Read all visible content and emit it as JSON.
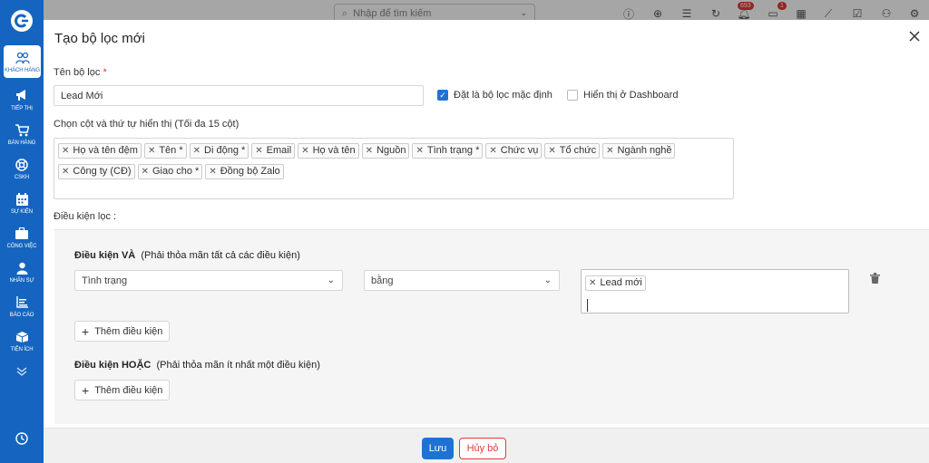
{
  "sidebar": {
    "logo_icon": "brand-logo-icon",
    "items": [
      {
        "label": "KHÁCH HÀNG",
        "icon": "users-icon",
        "active": true
      },
      {
        "label": "TIẾP THỊ",
        "icon": "megaphone-icon"
      },
      {
        "label": "BÁN HÀNG",
        "icon": "cart-icon"
      },
      {
        "label": "CSKH",
        "icon": "lifebuoy-icon"
      },
      {
        "label": "SỰ KIỆN",
        "icon": "calendar-icon"
      },
      {
        "label": "CÔNG VIỆC",
        "icon": "briefcase-icon"
      },
      {
        "label": "NHÂN SỰ",
        "icon": "person-icon"
      },
      {
        "label": "BÁO CÁO",
        "icon": "report-icon"
      },
      {
        "label": "TIỆN ÍCH",
        "icon": "box-icon"
      }
    ]
  },
  "topbar": {
    "search_placeholder": "Nhập để tìm kiếm",
    "notification_count": "693",
    "message_count": "1"
  },
  "modal": {
    "title": "Tạo bộ lọc mới",
    "name_label": "Tên bộ lọc",
    "required_mark": "*",
    "name_value": "Lead Mới",
    "default_filter_label": "Đặt là bộ lọc mặc định",
    "default_filter_checked": true,
    "dashboard_label": "Hiển thị ở Dashboard",
    "dashboard_checked": false,
    "columns_label": "Chọn cột và thứ tự hiển thị (Tối đa 15 cột)",
    "columns": [
      "Họ và tên đệm",
      "Tên *",
      "Di động *",
      "Email",
      "Họ và tên",
      "Nguồn",
      "Tình trạng *",
      "Chức vụ",
      "Tổ chức",
      "Ngành nghề",
      "Công ty (CĐ)",
      "Giao cho *",
      "Đồng bộ Zalo"
    ],
    "conditions_label": "Điều kiện lọc :",
    "and_group": {
      "title": "Điều kiện VÀ",
      "hint": "(Phải thỏa mãn tất cả các điều kiện)",
      "field": "Tình trạng",
      "operator": "bằng",
      "values": [
        "Lead mới"
      ],
      "add_label": "Thêm điều kiện"
    },
    "or_group": {
      "title": "Điều kiện HOẶC",
      "hint": "(Phải thỏa mãn ít nhất một điều kiện)",
      "add_label": "Thêm điều kiện"
    },
    "save_label": "Lưu",
    "cancel_label": "Hủy bỏ"
  }
}
